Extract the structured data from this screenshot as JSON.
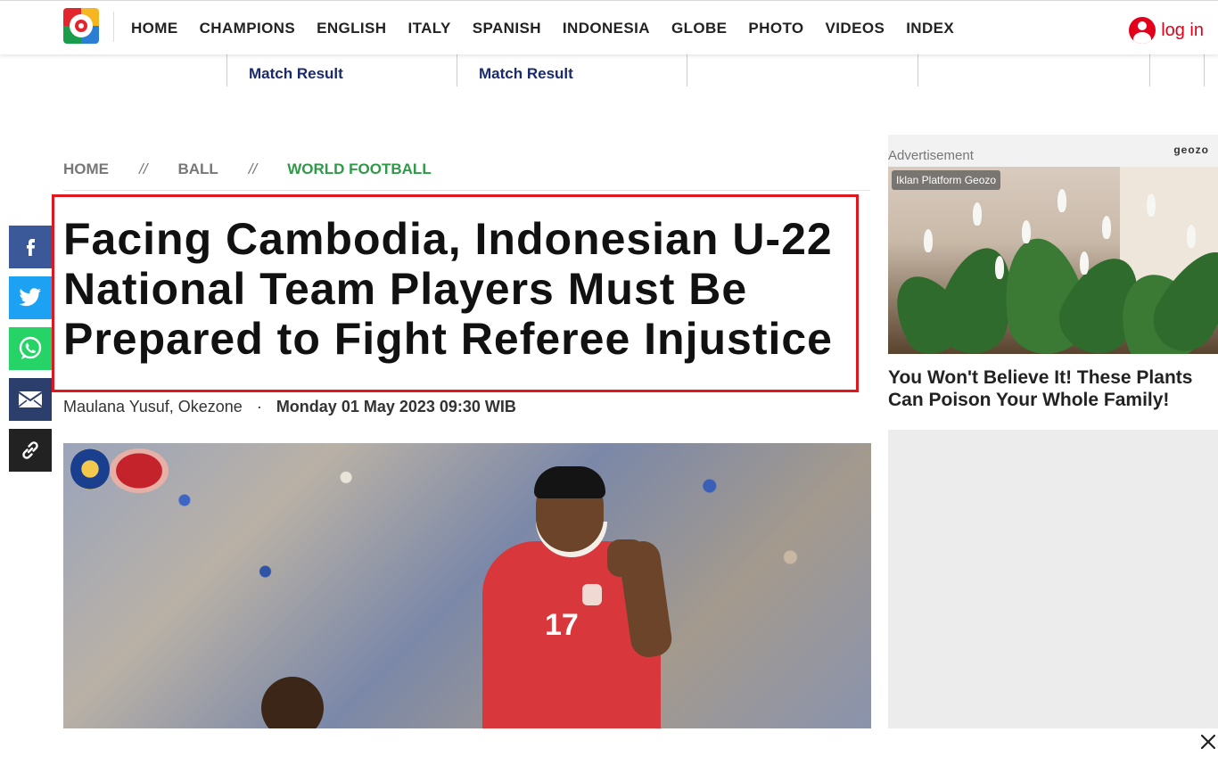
{
  "nav": {
    "items": [
      "HOME",
      "CHAMPIONS",
      "ENGLISH",
      "ITALY",
      "SPANISH",
      "INDONESIA",
      "GLOBE",
      "PHOTO",
      "VIDEOS",
      "INDEX"
    ],
    "login_label": "log in"
  },
  "match_strip": {
    "items": [
      "Match Result",
      "Match Result",
      "",
      "",
      ""
    ]
  },
  "breadcrumb": {
    "home": "HOME",
    "separator": "//",
    "section": "BALL",
    "current": "WORLD FOOTBALL"
  },
  "article": {
    "headline": "Facing Cambodia, Indonesian U-22 National Team Players Must Be Prepared to Fight Referee Injustice",
    "author": "Maulana Yusuf, Okezone",
    "separator": "·",
    "date": "Monday 01 May 2023 09:30 WIB",
    "image_jersey_number": "17"
  },
  "share": {
    "icons": [
      "facebook-icon",
      "twitter-icon",
      "whatsapp-icon",
      "email-icon",
      "link-icon"
    ]
  },
  "ad": {
    "label": "Advertisement",
    "logo": "geozo",
    "badge": "Iklan Platform Geozo",
    "title": "You Won't Believe It! These Plants Can Poison Your Whole Family!"
  },
  "colors": {
    "accent_red": "#e2001a",
    "breadcrumb_active": "#2e9a47",
    "match_text": "#1b2a6b",
    "highlight_box": "#e0171f"
  }
}
